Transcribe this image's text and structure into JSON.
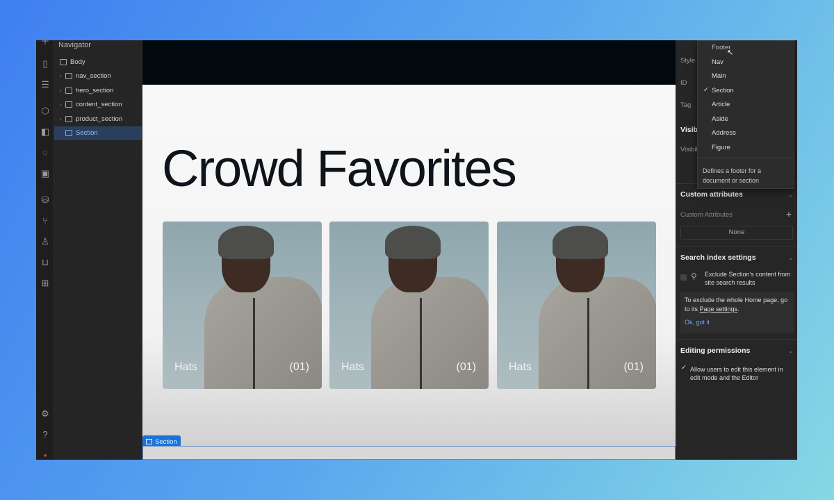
{
  "navigator": {
    "title": "Navigator",
    "items": [
      {
        "label": "Body",
        "expandable": false,
        "selected": false
      },
      {
        "label": "nav_section",
        "expandable": true,
        "selected": false
      },
      {
        "label": "hero_section",
        "expandable": true,
        "selected": false
      },
      {
        "label": "content_section",
        "expandable": true,
        "selected": false
      },
      {
        "label": "product_section",
        "expandable": true,
        "selected": false
      },
      {
        "label": "Section",
        "expandable": false,
        "selected": true
      }
    ]
  },
  "iconbar": [
    "add-icon",
    "page-icon",
    "navigator-icon",
    "components-icon",
    "styles-icon",
    "variables-icon",
    "assets-icon",
    "cms-icon",
    "logic-icon",
    "users-icon",
    "ecommerce-icon",
    "apps-icon",
    "settings-icon",
    "help-icon"
  ],
  "canvas": {
    "heading": "Crowd Favorites",
    "cards": [
      {
        "label": "Hats",
        "number": "(01)"
      },
      {
        "label": "Hats",
        "number": "(01)"
      },
      {
        "label": "Hats",
        "number": "(01)"
      }
    ],
    "selected_tag": "Section"
  },
  "panel": {
    "style_label": "Style",
    "id_label": "ID",
    "tag_label": "Tag",
    "visibility_heading": "Visib",
    "visibility_label": "Visibil",
    "custom_attributes": {
      "heading": "Custom attributes",
      "label": "Custom Attributes",
      "value": "None"
    },
    "search_index": {
      "heading": "Search index settings",
      "checkbox_label": "Exclude Section's content from site search results",
      "note": "To exclude the whole Home page, go to its ",
      "note_link": "Page settings",
      "note_end": ".",
      "dismiss": "Ok, got it"
    },
    "editing": {
      "heading": "Editing permissions",
      "checkbox_label": "Allow users to edit this element in edit mode and the Editor",
      "checked": true
    }
  },
  "tag_dropdown": {
    "options": [
      "Footer",
      "Nav",
      "Main",
      "Section",
      "Article",
      "Aside",
      "Address",
      "Figure"
    ],
    "selected": "Section",
    "hovered": "Footer",
    "description": "Defines a footer for a document or section"
  },
  "colors": {
    "accent": "#1a73d9",
    "selection": "#2a3f5e"
  }
}
